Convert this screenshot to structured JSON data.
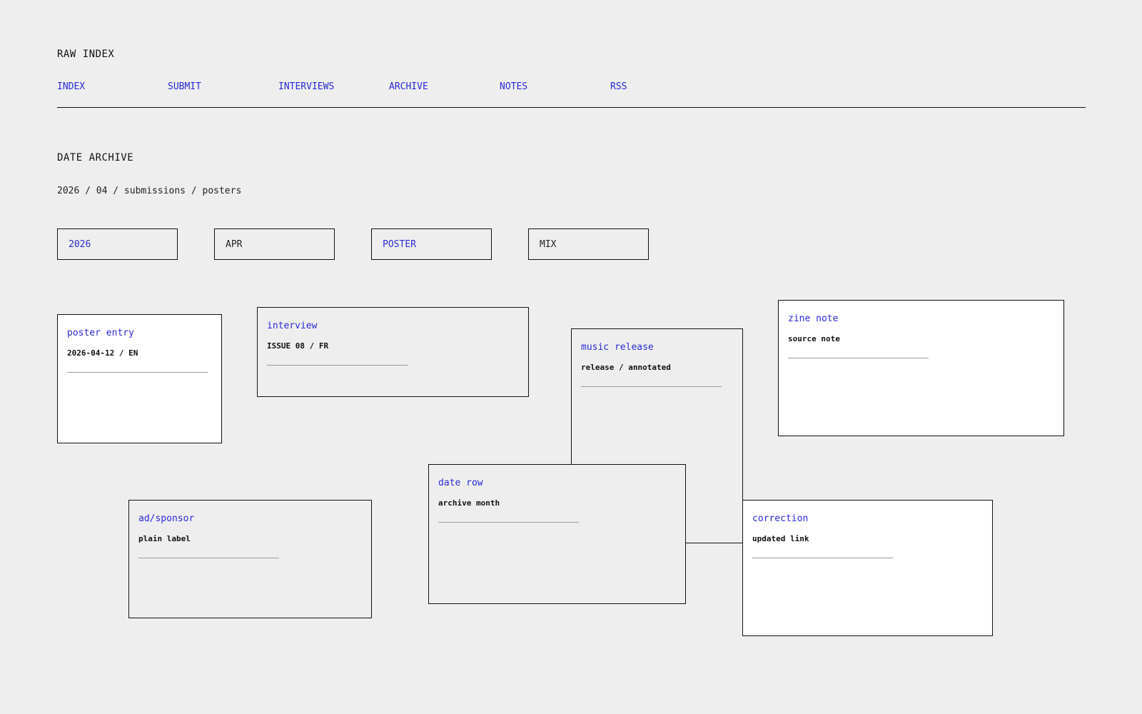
{
  "site": {
    "title": "RAW INDEX"
  },
  "nav": {
    "items": [
      "INDEX",
      "SUBMIT",
      "INTERVIEWS",
      "ARCHIVE",
      "NOTES",
      "RSS"
    ]
  },
  "archive": {
    "title": "DATE ARCHIVE",
    "breadcrumb": "2026 / 04 / submissions / posters"
  },
  "filters": [
    "2026",
    "APR",
    "POSTER",
    "MIX"
  ],
  "cards": [
    {
      "title": "poster entry",
      "subtitle": "2026-04-12 / EN"
    },
    {
      "title": "interview",
      "subtitle": "ISSUE 08 / FR"
    },
    {
      "title": "music release",
      "subtitle": "release / annotated"
    },
    {
      "title": "zine note",
      "subtitle": "source note"
    },
    {
      "title": "date row",
      "subtitle": "archive month"
    },
    {
      "title": "ad/sponsor",
      "subtitle": "plain label"
    },
    {
      "title": "correction",
      "subtitle": "updated link"
    }
  ],
  "colors": {
    "background": "#eeeeee",
    "link": "#2a2ad6",
    "text": "#111111",
    "card_white": "#ffffff"
  }
}
